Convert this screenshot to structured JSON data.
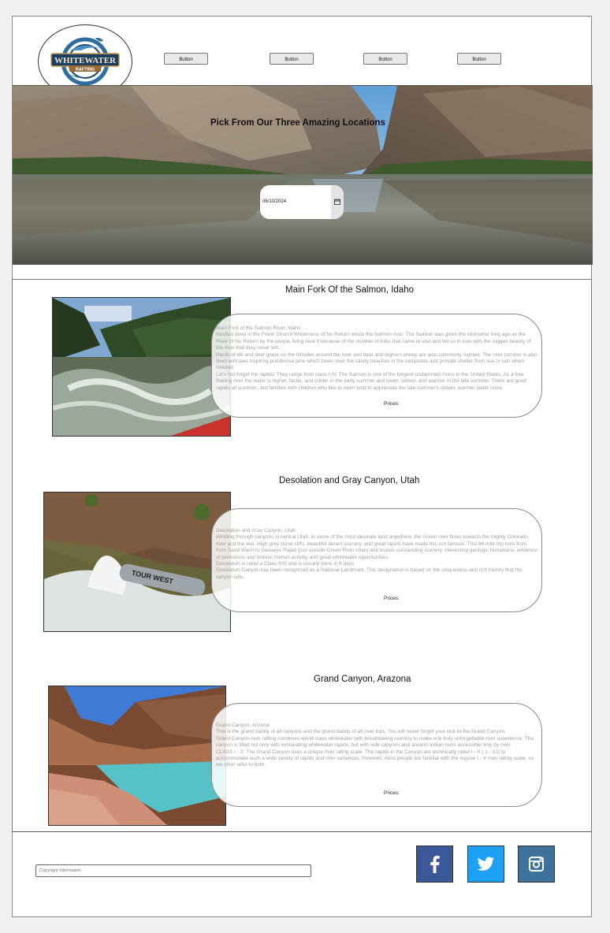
{
  "header": {
    "logo": {
      "line1": "WHITEWATER",
      "line2": "RAFTING"
    },
    "nav": [
      {
        "label": "Button"
      },
      {
        "label": "Button"
      },
      {
        "label": "Button"
      },
      {
        "label": "Button"
      }
    ]
  },
  "hero": {
    "title": "Pick From Our Three Amazing Locations",
    "date_value": "06/10/2024",
    "date_icon": "calendar-icon"
  },
  "locations": [
    {
      "title": "Main Fork Of the Salmon, Idaho",
      "paragraphs": [
        "Main Fork of the Salmon River, Idaho",
        "Nestled deep in the Frank Church Wilderness of No Return winds the Salmon river. The Salmon was given the nickname long ago as the River of No Return by the people living near it because of the number of folks that came to visit and fell so in love with the rugged beauty of the river that they never left.",
        "Herds of elk and deer graze on the hillsides around the river and bear and bighorn sheep are also commonly sighted. The river corridor is also lined with awe inspiring ponderosa pine which tower over the sandy beaches in the campsites and provide shelter from sun or rain when needed.",
        "Let's not forget the rapids! They range from class I-IV. The Salmon is one of the longest undammed rivers in the United States. As a free flowing river the water is higher, faster, and colder in the early summer and lower, slower, and warmer in the late summer. There are good rapids all summer...but families with children who like to swim tend to appreciate the late summer's slower, warmer water more."
      ],
      "prices_label": "Prices:"
    },
    {
      "title": "Desolation and Gray Canyon, Utah",
      "paragraphs": [
        "Desolation and Gray Canyon, Utah",
        "Winding through canyons in central Utah, in some of the most desolate land anywhere, the Green river flows towards the mighty Colorado river and the sea. High grey stone cliffs, beautiful desert scenery, and great rapids have made this run famous. This 84-mile trip runs from from Sand Wash to Swaseys Rapid (just outside Green River Utah) and boasts outstanding scenery, interesting geologic formations, evidence of prehistoric and historic human activity, and great whitewater opportunities.",
        "Desolation is rated a Class II/III and is usually done in 6 days",
        "Desolation Canyon has been recognized as a National Landmark.  This designation is based on the uniqueness and rich history that the canyon tells."
      ],
      "prices_label": "Prices:",
      "raft_text": "TOUR WEST"
    },
    {
      "title": "Grand Canyon, Arazona",
      "paragraphs": [
        "Grand Canyon, Arizona",
        "This is the grand daddy of all canyons and the grand daddy of all river trips. You will never forget your visit to the Grand Canyon.",
        "Grand Canyon river rafting combines world-class whitewater with breathtaking scenery to make one truly unforgettable river experience. The canyon is filled not only with exhilarating whitewater rapids, but with side canyons and ancient Indian ruins accessible only by river.",
        "CLASS I - X: The Grand Canyon uses a unique river rating scale. The rapids in the Canyon are technically rated I - X ( 1 - 10) to accommodate such a wide variety of rapids and river variances. However, most people are familiar with the regular I - V river rating scale, so we often refer to both."
      ],
      "prices_label": "Prices:"
    }
  ],
  "footer": {
    "copyright_placeholder": "Copyright Information",
    "social": [
      {
        "icon": "facebook-icon",
        "color": "#3b5998"
      },
      {
        "icon": "twitter-icon",
        "color": "#1da1f2"
      },
      {
        "icon": "instagram-icon",
        "color": "#3f729b"
      }
    ]
  }
}
